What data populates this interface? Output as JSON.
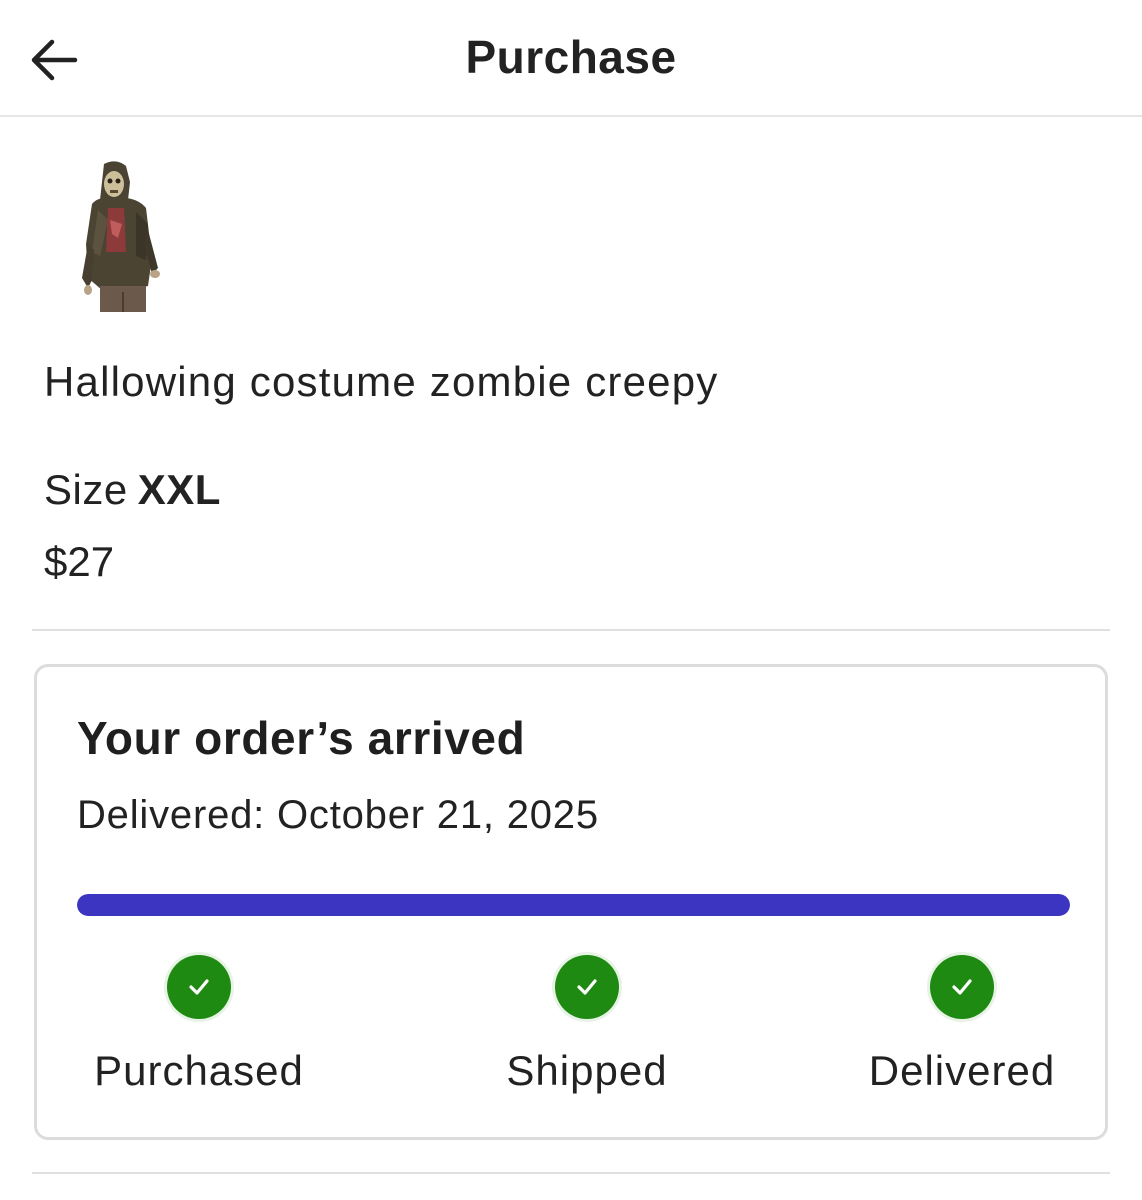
{
  "header": {
    "back_icon": "arrow-left-icon",
    "title": "Purchase"
  },
  "product": {
    "image_alt": "zombie-costume-image",
    "title": "Hallowing costume zombie creepy",
    "size_label": "Size",
    "size_value": "XXL",
    "price": "$27"
  },
  "order_status": {
    "heading": "Your order’s arrived",
    "delivered_text": "Delivered: October 21, 2025",
    "progress_fraction": 1.0,
    "progress_color": "#3b35c2",
    "steps": [
      {
        "label": "Purchased",
        "complete": true,
        "icon": "check-icon"
      },
      {
        "label": "Shipped",
        "complete": true,
        "icon": "check-icon"
      },
      {
        "label": "Delivered",
        "complete": true,
        "icon": "check-icon"
      }
    ],
    "complete_color": "#1f8a12"
  }
}
